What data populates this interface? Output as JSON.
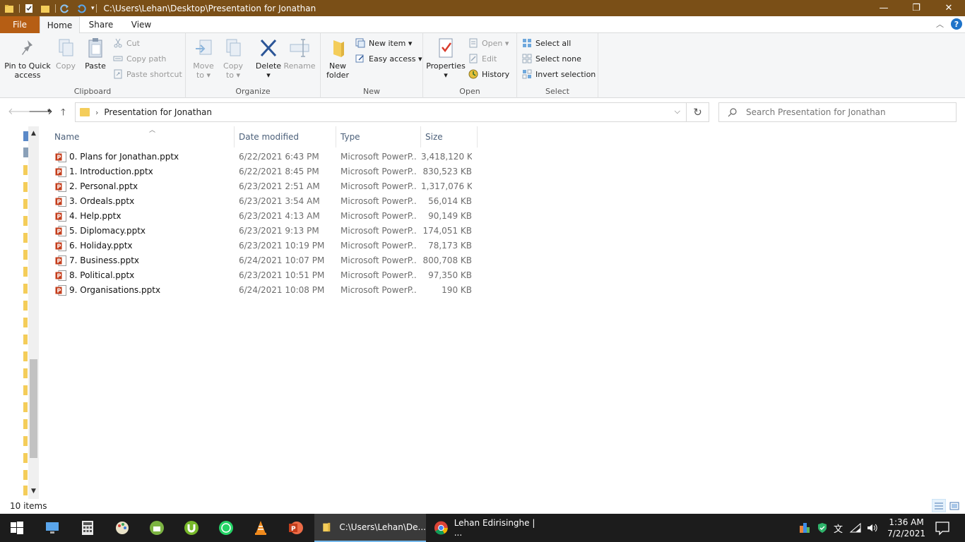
{
  "window": {
    "title_path": "C:\\Users\\Lehan\\Desktop\\Presentation for Jonathan",
    "minimize": "—",
    "restore": "❐",
    "close": "✕"
  },
  "ribbon_tabs": {
    "file": "File",
    "home": "Home",
    "share": "Share",
    "view": "View",
    "help": "?"
  },
  "ribbon": {
    "clipboard": {
      "label": "Clipboard",
      "pin_line1": "Pin to Quick",
      "pin_line2": "access",
      "copy": "Copy",
      "paste": "Paste",
      "cut": "Cut",
      "copy_path": "Copy path",
      "paste_shortcut": "Paste shortcut"
    },
    "organize": {
      "label": "Organize",
      "move_line1": "Move",
      "move_line2": "to ▾",
      "copy_line1": "Copy",
      "copy_line2": "to ▾",
      "delete_line1": "Delete",
      "delete_line2": "▾",
      "rename": "Rename"
    },
    "new": {
      "label": "New",
      "folder_line1": "New",
      "folder_line2": "folder",
      "new_item": "New item ▾",
      "easy_access": "Easy access ▾"
    },
    "open": {
      "label": "Open",
      "properties_line1": "Properties",
      "properties_line2": "▾",
      "open": "Open ▾",
      "edit": "Edit",
      "history": "History"
    },
    "select": {
      "label": "Select",
      "select_all": "Select all",
      "select_none": "Select none",
      "invert": "Invert selection"
    }
  },
  "address": {
    "folder": "Presentation for Jonathan",
    "search_placeholder": "Search Presentation for Jonathan"
  },
  "columns": {
    "name": "Name",
    "date": "Date modified",
    "type": "Type",
    "size": "Size"
  },
  "files": [
    {
      "name": "0. Plans for Jonathan.pptx",
      "date": "6/22/2021 6:43 PM",
      "type": "Microsoft PowerP...",
      "size": "3,418,120 KB"
    },
    {
      "name": "1. Introduction.pptx",
      "date": "6/22/2021 8:45 PM",
      "type": "Microsoft PowerP...",
      "size": "830,523 KB"
    },
    {
      "name": "2. Personal.pptx",
      "date": "6/23/2021 2:51 AM",
      "type": "Microsoft PowerP...",
      "size": "1,317,076 KB"
    },
    {
      "name": "3. Ordeals.pptx",
      "date": "6/23/2021 3:54 AM",
      "type": "Microsoft PowerP...",
      "size": "56,014 KB"
    },
    {
      "name": "4. Help.pptx",
      "date": "6/23/2021 4:13 AM",
      "type": "Microsoft PowerP...",
      "size": "90,149 KB"
    },
    {
      "name": "5. Diplomacy.pptx",
      "date": "6/23/2021 9:13 PM",
      "type": "Microsoft PowerP...",
      "size": "174,051 KB"
    },
    {
      "name": "6. Holiday.pptx",
      "date": "6/23/2021 10:19 PM",
      "type": "Microsoft PowerP...",
      "size": "78,173 KB"
    },
    {
      "name": "7. Business.pptx",
      "date": "6/24/2021 10:07 PM",
      "type": "Microsoft PowerP...",
      "size": "800,708 KB"
    },
    {
      "name": "8. Political.pptx",
      "date": "6/23/2021 10:51 PM",
      "type": "Microsoft PowerP...",
      "size": "97,350 KB"
    },
    {
      "name": "9. Organisations.pptx",
      "date": "6/24/2021 10:08 PM",
      "type": "Microsoft PowerP...",
      "size": "190 KB"
    }
  ],
  "status": {
    "item_count": "10 items"
  },
  "taskbar": {
    "explorer_window": "C:\\Users\\Lehan\\De...",
    "chrome_window": "Lehan Edirisinghe | ...",
    "time": "1:36 AM",
    "date": "7/2/2021",
    "ime": "文"
  },
  "colors": {
    "titlebar": "#7a4f17",
    "file_tab": "#b65e14",
    "accent": "#1e73c9",
    "folder": "#f4cd5a",
    "powerpoint": "#c43e1c"
  }
}
